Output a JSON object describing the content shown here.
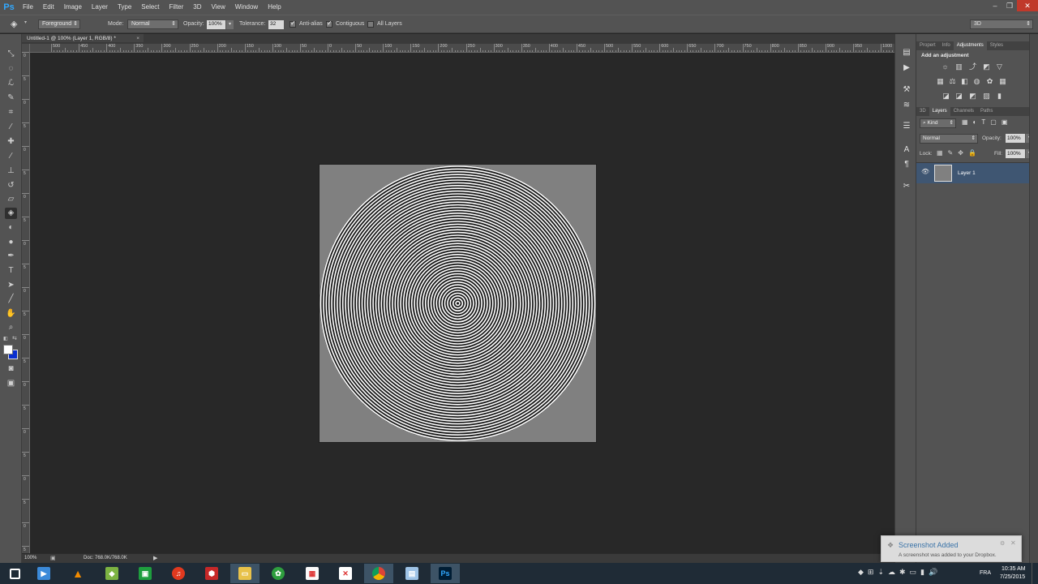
{
  "app": {
    "logo": "Ps"
  },
  "menu": [
    "File",
    "Edit",
    "Image",
    "Layer",
    "Type",
    "Select",
    "Filter",
    "3D",
    "View",
    "Window",
    "Help"
  ],
  "window_controls": {
    "minimize": "‒",
    "restore": "❐",
    "close": "✕"
  },
  "options": {
    "fill_source": "Foreground",
    "mode_label": "Mode:",
    "mode_value": "Normal",
    "opacity_label": "Opacity:",
    "opacity_value": "100%",
    "tolerance_label": "Tolerance:",
    "tolerance_value": "32",
    "antialias_label": "Anti-alias",
    "contiguous_label": "Contiguous",
    "all_layers_label": "All Layers",
    "workspace": "3D"
  },
  "document": {
    "tab_title": "Untitled-1 @ 100% (Layer 1, RGB/8) *",
    "tab_close": "×",
    "status_zoom": "100%",
    "status_doc": "Doc: 768.0K/768.0K"
  },
  "ruler_labels": [
    "500",
    "450",
    "400",
    "350",
    "300",
    "250",
    "200",
    "150",
    "100",
    "50",
    "0",
    "50",
    "100",
    "150",
    "200",
    "250",
    "300",
    "350",
    "400",
    "450",
    "500",
    "550",
    "600",
    "650",
    "700",
    "750",
    "800",
    "850",
    "900",
    "950",
    "1000"
  ],
  "vruler_labels": [
    "0",
    "5",
    "0",
    "5",
    "0",
    "5",
    "0",
    "5",
    "0",
    "5",
    "0",
    "5",
    "0",
    "5",
    "0",
    "5",
    "0",
    "5",
    "0",
    "5",
    "0",
    "5"
  ],
  "panels": {
    "top_tabs": [
      "Propert",
      "Info",
      "Adjustments",
      "Styles"
    ],
    "top_active": "Adjustments",
    "adjust_title": "Add an adjustment",
    "layer_tabs": [
      "3D",
      "Layers",
      "Channels",
      "Paths"
    ],
    "layer_active": "Layers",
    "kind_label": "Kind",
    "blend_mode": "Normal",
    "opacity_label": "Opacity:",
    "opacity_value": "100%",
    "lock_label": "Lock:",
    "fill_label": "Fill:",
    "fill_value": "100%",
    "layer_name": "Layer 1"
  },
  "toast": {
    "title": "Screenshot Added",
    "body": "A screenshot was added to your Dropbox."
  },
  "taskbar": {
    "lang": "FRA",
    "time": "10:35 AM",
    "date": "7/25/2015"
  },
  "colors": {
    "canvas_bg": "#808080",
    "ring": "#ffffff",
    "ring_gap": "#1a1a1a",
    "accent": "#31a8ff",
    "layer_selected": "#3f5672"
  },
  "icons": {
    "tools": [
      "move-icon",
      "marquee-icon",
      "lasso-icon",
      "quick-select-icon",
      "crop-icon",
      "eyedropper-icon",
      "healing-brush-icon",
      "brush-icon",
      "clone-stamp-icon",
      "history-brush-icon",
      "eraser-icon",
      "paint-bucket-icon",
      "blur-icon",
      "dodge-icon",
      "pen-icon",
      "type-icon",
      "path-select-icon",
      "line-icon",
      "hand-icon",
      "zoom-icon"
    ],
    "dock": [
      "history-icon",
      "actions-icon",
      "tool-presets-icon",
      "brush-presets-icon",
      "layer-comps-icon",
      "character-icon",
      "paragraph-icon",
      "tools-icon"
    ]
  }
}
